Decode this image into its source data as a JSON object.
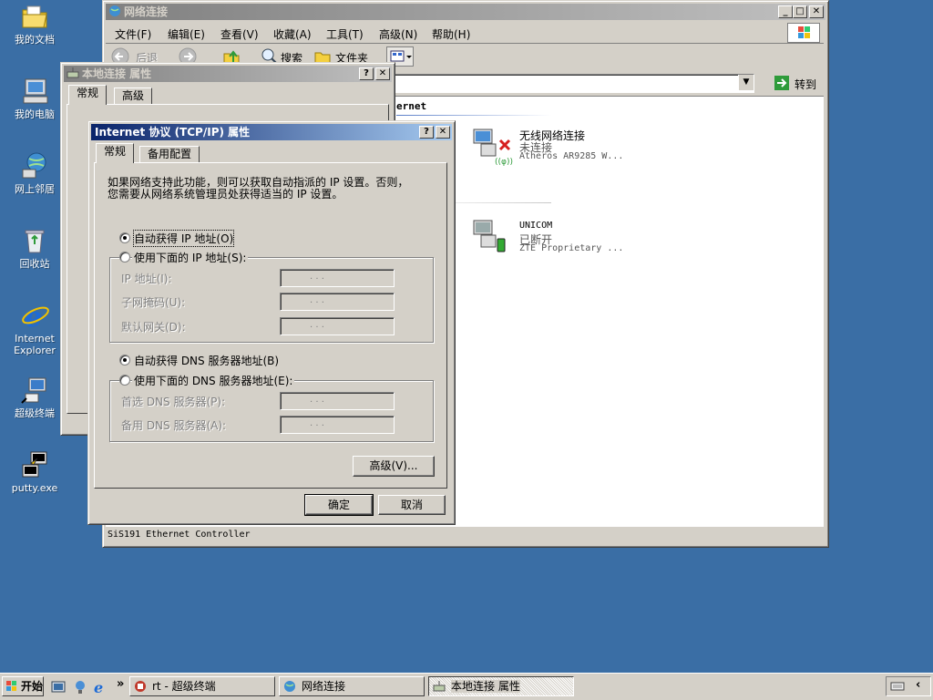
{
  "desktop": {
    "icons": [
      {
        "label": "我的文档"
      },
      {
        "label": "我的电脑"
      },
      {
        "label": "网上邻居"
      },
      {
        "label": "回收站"
      },
      {
        "label": "Internet Explorer"
      },
      {
        "label": "超级终端"
      },
      {
        "label": "putty.exe"
      }
    ]
  },
  "netwin": {
    "title": "网络连接",
    "menu": [
      "文件(F)",
      "编辑(E)",
      "查看(V)",
      "收藏(A)",
      "工具(T)",
      "高级(N)",
      "帮助(H)"
    ],
    "toolbar": {
      "back": "后退",
      "search": "搜索",
      "folders": "文件夹"
    },
    "go_label": "转到",
    "section_fragment": "ernet",
    "connections": [
      {
        "name": "无线网络连接",
        "status": "未连接",
        "device": "Atheros AR9285 W..."
      },
      {
        "name": "UNICOM",
        "status": "已断开",
        "device": "ZTE Proprietary ..."
      }
    ],
    "statusbar": "SiS191 Ethernet Controller"
  },
  "localprops": {
    "title": "本地连接 属性",
    "tabs": [
      "常规",
      "高级"
    ]
  },
  "tcpip": {
    "title": "Internet 协议 (TCP/IP) 属性",
    "tabs": [
      "常规",
      "备用配置"
    ],
    "description_line1": "如果网络支持此功能，则可以获取自动指派的 IP 设置。否则，",
    "description_line2": "您需要从网络系统管理员处获得适当的 IP 设置。",
    "auto_ip_label": "自动获得 IP 地址(O)",
    "manual_ip_label": "使用下面的 IP 地址(S):",
    "ip_address_label": "IP 地址(I):",
    "subnet_label": "子网掩码(U):",
    "gateway_label": "默认网关(D):",
    "auto_dns_label": "自动获得 DNS 服务器地址(B)",
    "manual_dns_label": "使用下面的 DNS 服务器地址(E):",
    "preferred_dns_label": "首选 DNS 服务器(P):",
    "alternate_dns_label": "备用 DNS 服务器(A):",
    "ip_placeholder": ".     .     .",
    "advanced_button": "高级(V)...",
    "ok_button": "确定",
    "cancel_button": "取消",
    "auto_ip_selected": true,
    "auto_dns_selected": true
  },
  "taskbar": {
    "start": "开始",
    "chevron": "»",
    "tasks": [
      {
        "label": "rt - 超级终端"
      },
      {
        "label": "网络连接"
      },
      {
        "label": "本地连接 属性"
      }
    ]
  }
}
